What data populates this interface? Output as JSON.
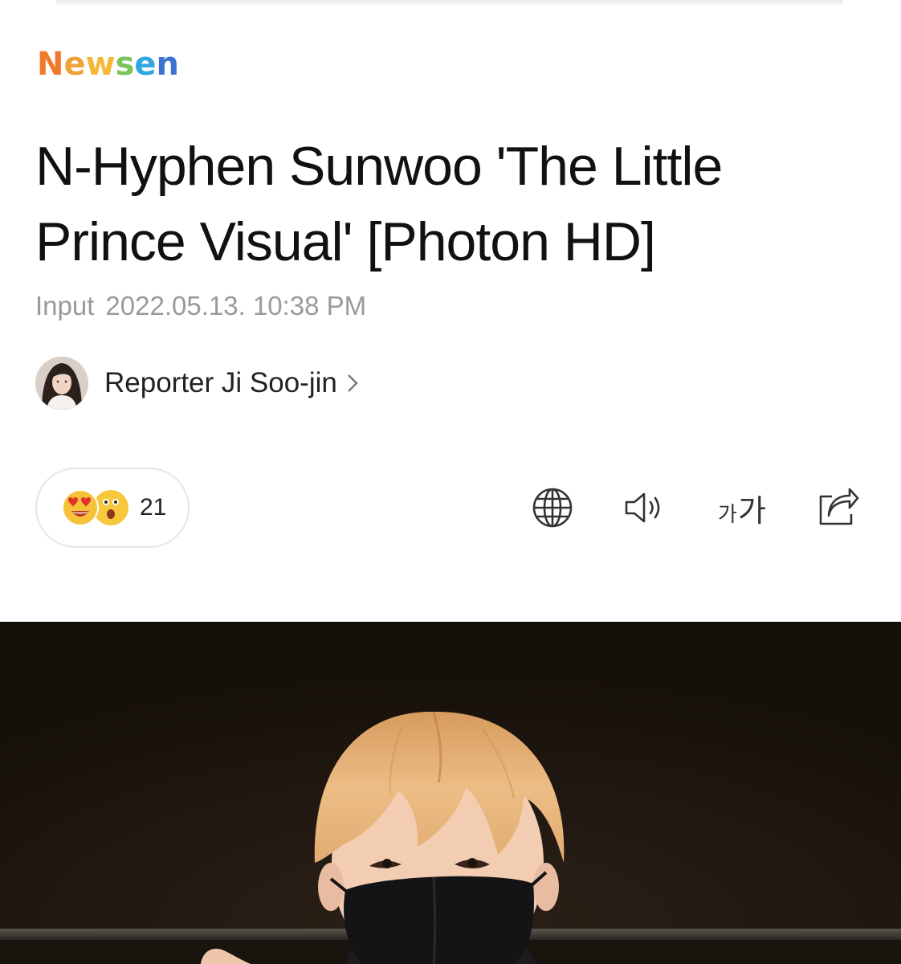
{
  "brand": {
    "logo_letters": [
      "N",
      "e",
      "w",
      "s",
      "e",
      "n"
    ],
    "logo_colors": [
      "#f0792b",
      "#f0a23a",
      "#f5c43a",
      "#7cc35a",
      "#2fa6e0",
      "#3b74d0"
    ]
  },
  "article": {
    "headline": "N-Hyphen Sunwoo 'The Little Prince Visual' [Photon HD]",
    "input_label": "Input",
    "input_datetime": "2022.05.13. 10:38 PM",
    "reporter": "Reporter Ji Soo-jin"
  },
  "reactions": {
    "count": "21",
    "icons": [
      "heart-eyes-emoji",
      "surprised-emoji"
    ]
  },
  "toolbar": {
    "icons": [
      "globe-icon",
      "speaker-icon",
      "font-size-icon",
      "share-icon"
    ],
    "font_small": "가",
    "font_large": "가"
  },
  "colors": {
    "headline": "#111111",
    "meta": "#9a9a9a",
    "photo_bg": "#1b140e",
    "hair": "#e7b57a"
  }
}
